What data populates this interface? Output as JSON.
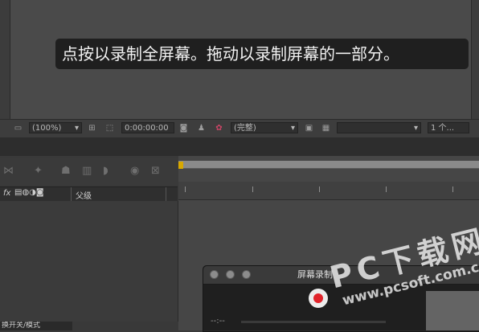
{
  "tooltip": {
    "text": "点按以录制全屏幕。拖动以录制屏幕的一部分。"
  },
  "viewer_toolbar": {
    "zoom": "(100%)",
    "timecode": "0:00:00:00",
    "resolution": "(完整)",
    "views": "1 个..."
  },
  "timeline": {
    "column_fx": "fx",
    "column_parent": "父级",
    "bottom_label": "换开关/模式"
  },
  "recorder": {
    "title": "屏幕录制",
    "time": "--:--"
  },
  "watermark": {
    "brand": "PC下载网",
    "url": "www.pcsoft.com.cn"
  },
  "colors": {
    "record_red": "#e1232a",
    "tooltip_bg": "#1f1f1f",
    "playhead": "#d8a800"
  }
}
